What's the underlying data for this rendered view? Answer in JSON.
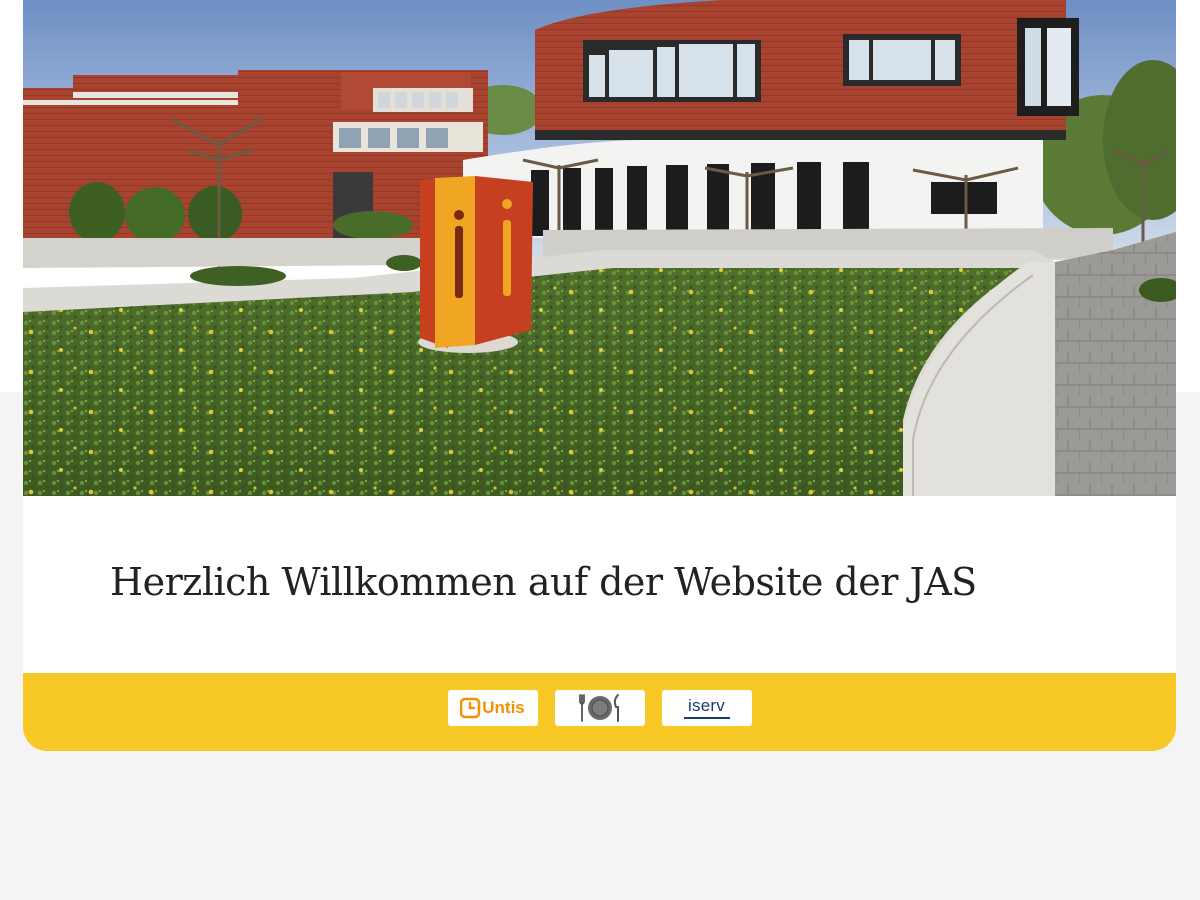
{
  "hero": {
    "alt": "Schulgebäude der JAS mit Skulptur im Innenhof"
  },
  "welcome": {
    "title": "Herzlich Willkommen auf der Website der JAS"
  },
  "quick_links": [
    {
      "label": "Untis",
      "icon": "untis-clock-icon",
      "color": "#f39200"
    },
    {
      "label": "",
      "icon": "plate-cutlery-icon",
      "color": "#555555"
    },
    {
      "label": "iserv",
      "icon": "iserv-logo",
      "color": "#1a3d6e"
    }
  ],
  "colors": {
    "page_bg": "#f4f4f4",
    "bar_bg": "#f8c827",
    "title_text": "#222222"
  }
}
